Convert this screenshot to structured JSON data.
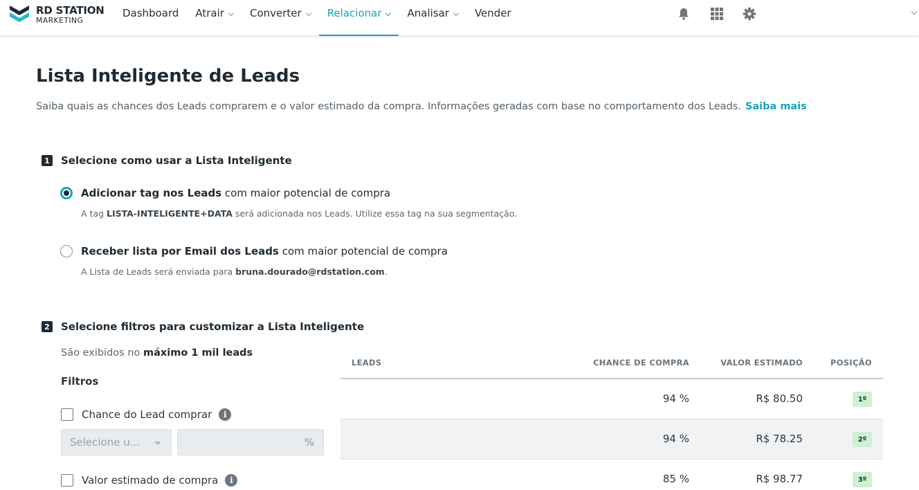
{
  "brand": {
    "line1": "RD STATION",
    "line2": "MARKETING"
  },
  "nav": {
    "items": [
      {
        "label": "Dashboard",
        "has_menu": false,
        "active": false
      },
      {
        "label": "Atrair",
        "has_menu": true,
        "active": false
      },
      {
        "label": "Converter",
        "has_menu": true,
        "active": false
      },
      {
        "label": "Relacionar",
        "has_menu": true,
        "active": true
      },
      {
        "label": "Analisar",
        "has_menu": true,
        "active": false
      },
      {
        "label": "Vender",
        "has_menu": false,
        "active": false
      }
    ],
    "icons": [
      "bell-icon",
      "apps-grid-icon",
      "gear-icon"
    ]
  },
  "page": {
    "title": "Lista Inteligente de Leads",
    "description": "Saiba quais as chances dos Leads comprarem e o valor estimado da compra. Informações geradas com base no comportamento dos Leads.",
    "learn_more": "Saiba mais"
  },
  "step1": {
    "number": "1",
    "label": "Selecione como usar a Lista Inteligente",
    "option_tag": {
      "bold": "Adicionar tag nos Leads",
      "rest": " com maior potencial de compra",
      "help_pre": "A tag ",
      "help_bold": "LISTA-INTELIGENTE+DATA",
      "help_post": " será adicionada nos Leads. Utilize essa tag na sua segmentação.",
      "checked": true
    },
    "option_email": {
      "bold": "Receber lista por Email dos Leads",
      "rest": " com maior potencial de compra",
      "help_pre": "A Lista de Leads será enviada para ",
      "help_bold": "bruna.dourado@rdstation.com",
      "help_post": ".",
      "checked": false
    }
  },
  "step2": {
    "number": "2",
    "label": "Selecione filtros para customizar a Lista Inteligente",
    "max_pre": "São exibidos no ",
    "max_bold": "máximo 1 mil leads",
    "filters_title": "Filtros",
    "filter_chance": "Chance do Lead comprar",
    "select_placeholder": "Selecione u...",
    "percent_symbol": "%",
    "filter_value": "Valor estimado de compra",
    "info_glyph": "i"
  },
  "table": {
    "headers": {
      "leads": "LEADS",
      "chance": "CHANCE DE COMPRA",
      "value": "VALOR ESTIMADO",
      "position": "POSIÇÃO"
    },
    "rows": [
      {
        "chance": "94 %",
        "value": "R$ 80.50",
        "position": "1º"
      },
      {
        "chance": "94 %",
        "value": "R$ 78.25",
        "position": "2º"
      },
      {
        "chance": "85 %",
        "value": "R$ 98.77",
        "position": "3º"
      }
    ]
  },
  "colors": {
    "accent": "#1aa3b8",
    "badge": "#cdf1d3",
    "dark": "#1e2a33"
  }
}
